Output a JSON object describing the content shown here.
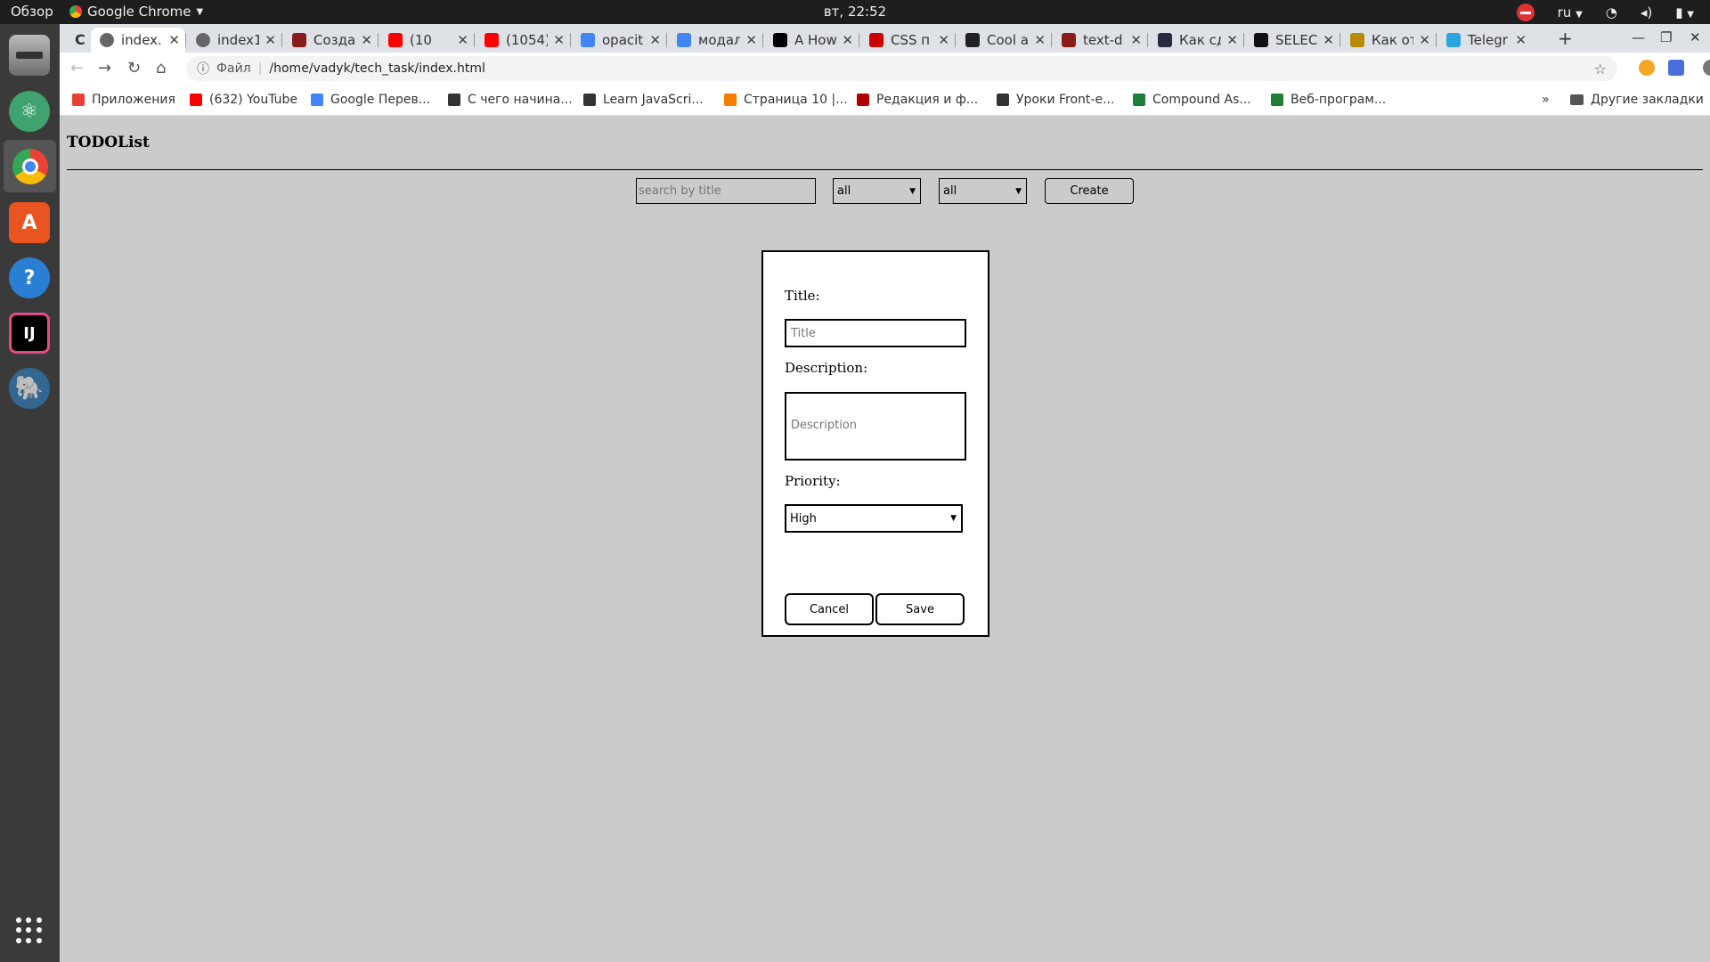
{
  "os": {
    "overview_label": "Обзор",
    "app_name": "Google Chrome",
    "clock": "вт, 22:52",
    "lang": "ru"
  },
  "dock": {
    "items": [
      "files-icon",
      "atom-icon",
      "chrome-icon",
      "software-center-icon",
      "help-icon",
      "intellij-icon",
      "postgres-icon"
    ]
  },
  "browser": {
    "tabs": [
      {
        "title": "index.l",
        "icon": "globe-icon"
      },
      {
        "title": "index1",
        "icon": "globe-icon"
      },
      {
        "title": "Созда",
        "icon": "R-icon"
      },
      {
        "title": "(10",
        "icon": "youtube-icon"
      },
      {
        "title": "(1054)",
        "icon": "youtube-icon"
      },
      {
        "title": "opacit",
        "icon": "google-icon"
      },
      {
        "title": "модал",
        "icon": "google-icon"
      },
      {
        "title": "A How",
        "icon": "medium-icon"
      },
      {
        "title": "CSS п",
        "icon": "doc-icon"
      },
      {
        "title": "Cool a",
        "icon": "fi-icon"
      },
      {
        "title": "text-d",
        "icon": "mdn-icon"
      },
      {
        "title": "Как сд",
        "icon": "T-icon"
      },
      {
        "title": "SELEC",
        "icon": "codepen-icon"
      },
      {
        "title": "Как от",
        "icon": "glasses-icon"
      },
      {
        "title": "Telegr",
        "icon": "telegram-icon"
      }
    ],
    "address": {
      "scheme_label": "Файл",
      "url": "/home/vadyk/tech_task/index.html"
    },
    "bookmarks": [
      {
        "label": "Приложения",
        "color": "#e94235"
      },
      {
        "label": "(632) YouTube",
        "color": "#ff0000"
      },
      {
        "label": "Google Перев...",
        "color": "#4285f4"
      },
      {
        "label": "С чего начина...",
        "color": "#333333"
      },
      {
        "label": "Learn JavaScri...",
        "color": "#333333"
      },
      {
        "label": "Страница 10 |...",
        "color": "#f57d00"
      },
      {
        "label": "Редакция и ф...",
        "color": "#b00000"
      },
      {
        "label": "Уроки Front-e...",
        "color": "#333333"
      },
      {
        "label": "Compound As...",
        "color": "#1e7e34"
      },
      {
        "label": "Веб-програм...",
        "color": "#1e7e34"
      }
    ],
    "more_bookmarks": "»",
    "other_bookmarks": "Другие закладки"
  },
  "app": {
    "title": "TODOList",
    "search": {
      "placeholder": "search by title"
    },
    "filter_status": "all",
    "filter_priority": "all",
    "create_label": "Create"
  },
  "modal": {
    "title_label": "Title:",
    "title_placeholder": "Title",
    "description_label": "Description:",
    "description_placeholder": "Description",
    "priority_label": "Priority:",
    "priority_value": "High",
    "cancel_label": "Cancel",
    "save_label": "Save"
  }
}
